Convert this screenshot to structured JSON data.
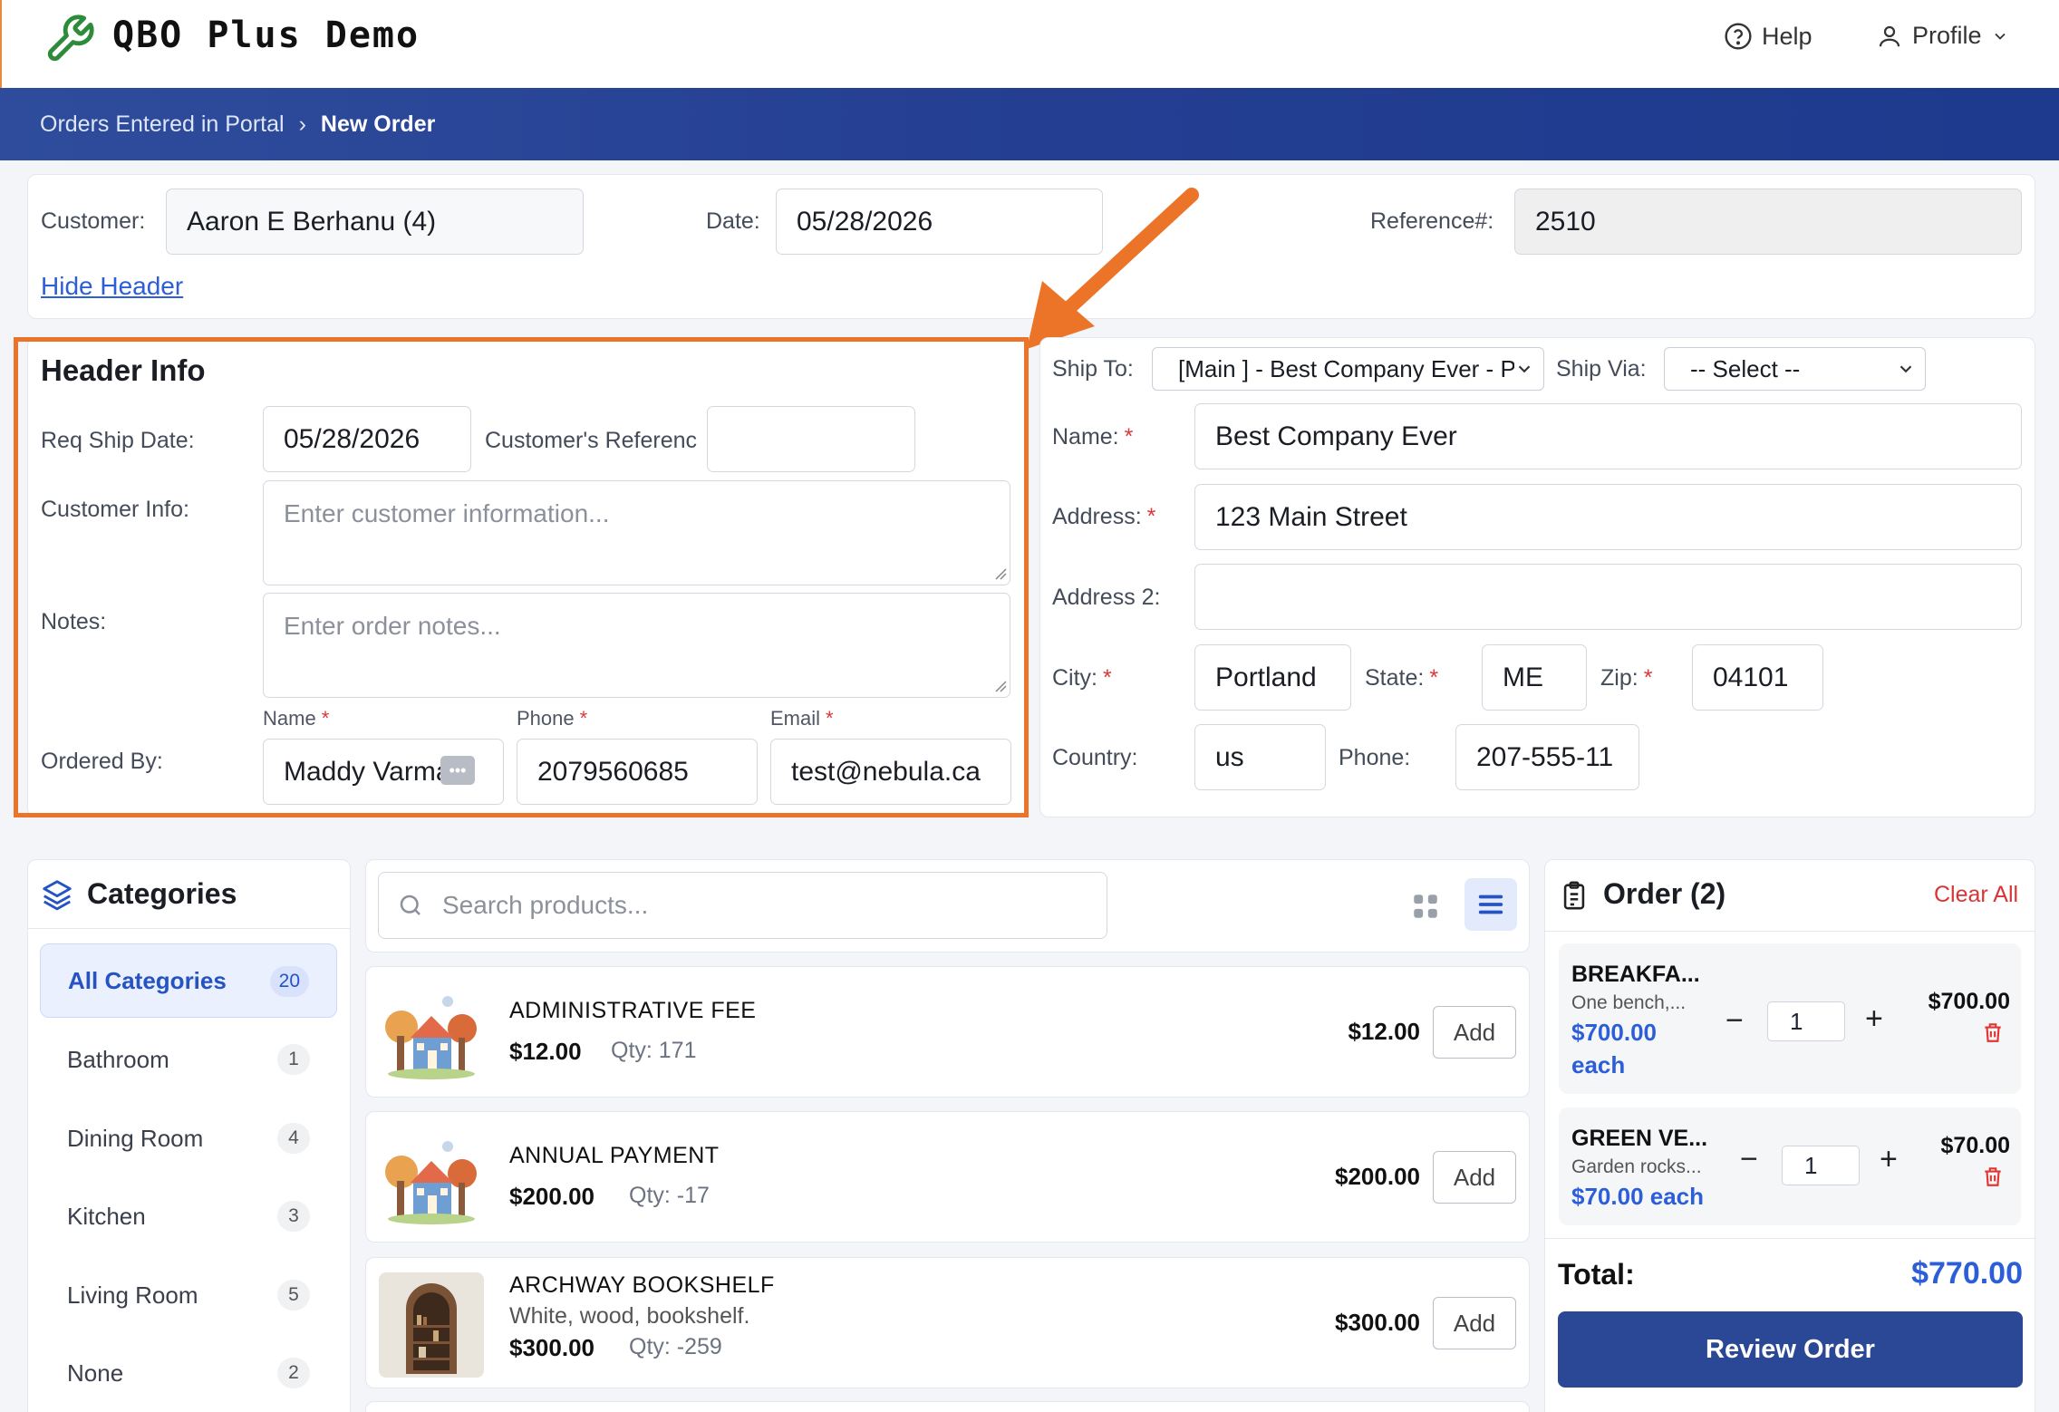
{
  "app": {
    "title": "QBO Plus Demo",
    "help": "Help",
    "profile": "Profile"
  },
  "breadcrumb": {
    "parent": "Orders Entered in Portal",
    "separator": "›",
    "current": "New Order"
  },
  "top_form": {
    "customer_label": "Customer:",
    "customer_value": "Aaron E Berhanu (4)",
    "date_label": "Date:",
    "date_value": "05/28/2026",
    "reference_label": "Reference#:",
    "reference_value": "2510",
    "hide_header": "Hide Header"
  },
  "header_info": {
    "title": "Header Info",
    "req_ship_label": "Req Ship Date:",
    "req_ship_value": "05/28/2026",
    "cust_ref_label": "Customer's Referenc",
    "cust_ref_value": "",
    "customer_info_label": "Customer Info:",
    "customer_info_placeholder": "Enter customer information...",
    "notes_label": "Notes:",
    "notes_placeholder": "Enter order notes...",
    "ordered_by_label": "Ordered By:",
    "name_label": "Name",
    "phone_label": "Phone",
    "email_label": "Email",
    "req_mark": "*",
    "name_value": "Maddy Varma",
    "phone_value": "2079560685",
    "email_value": "test@nebula.ca"
  },
  "ship": {
    "ship_to_label": "Ship To:",
    "ship_to_value": "[Main ] - Best Company Ever - Po",
    "ship_via_label": "Ship Via:",
    "ship_via_value": "-- Select --",
    "name_label": "Name:",
    "name_value": "Best Company Ever",
    "address_label": "Address:",
    "address_value": "123 Main Street",
    "address2_label": "Address 2:",
    "address2_value": "",
    "city_label": "City:",
    "city_value": "Portland",
    "state_label": "State:",
    "state_value": "ME",
    "zip_label": "Zip:",
    "zip_value": "04101",
    "country_label": "Country:",
    "country_value": "us",
    "phone_label": "Phone:",
    "phone_value": "207-555-11",
    "req_mark": "*"
  },
  "categories": {
    "title": "Categories",
    "items": [
      {
        "label": "All Categories",
        "count": "20"
      },
      {
        "label": "Bathroom",
        "count": "1"
      },
      {
        "label": "Dining Room",
        "count": "4"
      },
      {
        "label": "Kitchen",
        "count": "3"
      },
      {
        "label": "Living Room",
        "count": "5"
      },
      {
        "label": "None",
        "count": "2"
      }
    ]
  },
  "search": {
    "placeholder": "Search products..."
  },
  "products": [
    {
      "name": "ADMINISTRATIVE FEE",
      "desc": "",
      "price": "$12.00",
      "qty": "Qty: 171",
      "right_price": "$12.00",
      "add": "Add"
    },
    {
      "name": "ANNUAL PAYMENT",
      "desc": "",
      "price": "$200.00",
      "qty": "Qty: -17",
      "right_price": "$200.00",
      "add": "Add"
    },
    {
      "name": "ARCHWAY BOOKSHELF",
      "desc": "White, wood, bookshelf.",
      "price": "$300.00",
      "qty": "Qty: -259",
      "right_price": "$300.00",
      "add": "Add"
    }
  ],
  "order": {
    "title": "Order (2)",
    "clear_all": "Clear All",
    "items": [
      {
        "name": "BREAKFA...",
        "desc": "One bench,...",
        "each_line1": "$700.00",
        "each_line2": "each",
        "qty": "1",
        "total": "$700.00"
      },
      {
        "name": "GREEN VE...",
        "desc": "Garden rocks...",
        "each_line1": "$70.00 each",
        "each_line2": "",
        "qty": "1",
        "total": "$70.00"
      }
    ],
    "total_label": "Total:",
    "total_value": "$770.00",
    "review_button": "Review Order"
  },
  "colors": {
    "brand_blue": "#243f92",
    "accent_orange": "#ec7428",
    "link_blue": "#2c5ed8",
    "danger_red": "#e03636"
  }
}
